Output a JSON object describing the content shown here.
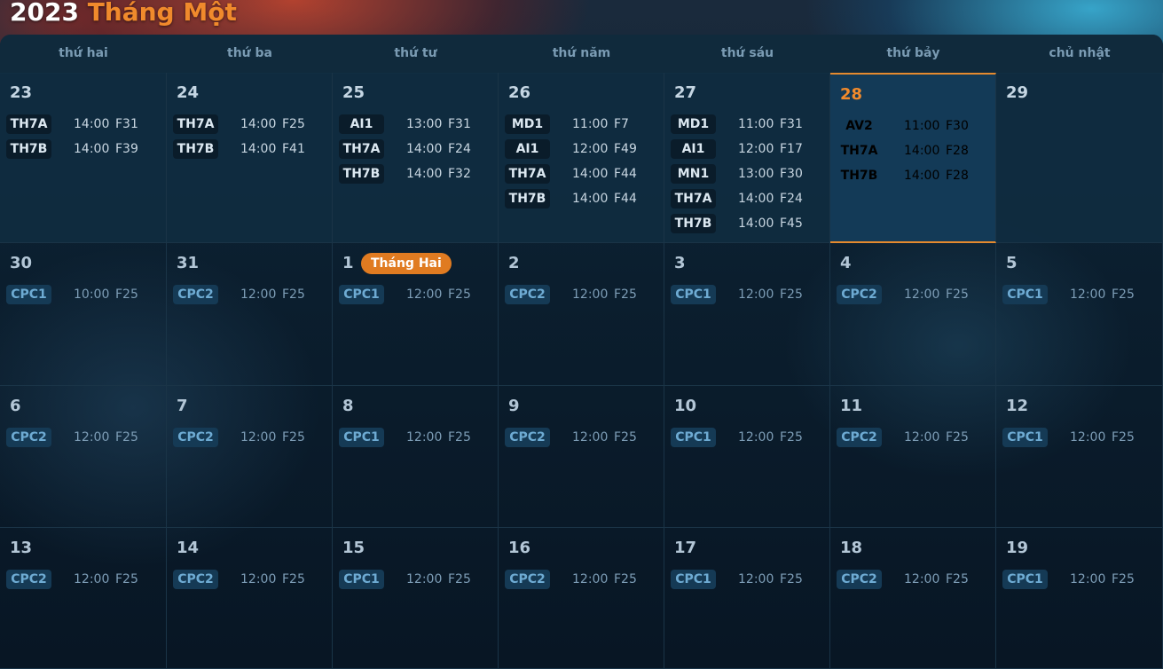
{
  "header": {
    "year": "2023",
    "month": "Tháng Một"
  },
  "weekdays": [
    "thứ hai",
    "thứ ba",
    "thứ tư",
    "thứ năm",
    "thứ sáu",
    "thứ bảy",
    "chủ nhật"
  ],
  "weeks": [
    [
      {
        "day": "23",
        "state": "past",
        "events": [
          {
            "code": "TH7A",
            "time": "14:00",
            "room": "F31"
          },
          {
            "code": "TH7B",
            "time": "14:00",
            "room": "F39"
          }
        ]
      },
      {
        "day": "24",
        "state": "past",
        "events": [
          {
            "code": "TH7A",
            "time": "14:00",
            "room": "F25"
          },
          {
            "code": "TH7B",
            "time": "14:00",
            "room": "F41"
          }
        ]
      },
      {
        "day": "25",
        "state": "past",
        "events": [
          {
            "code": "AI1",
            "time": "13:00",
            "room": "F31"
          },
          {
            "code": "TH7A",
            "time": "14:00",
            "room": "F24"
          },
          {
            "code": "TH7B",
            "time": "14:00",
            "room": "F32"
          }
        ]
      },
      {
        "day": "26",
        "state": "past",
        "events": [
          {
            "code": "MD1",
            "time": "11:00",
            "room": "F7"
          },
          {
            "code": "AI1",
            "time": "12:00",
            "room": "F49"
          },
          {
            "code": "TH7A",
            "time": "14:00",
            "room": "F44"
          },
          {
            "code": "TH7B",
            "time": "14:00",
            "room": "F44"
          }
        ]
      },
      {
        "day": "27",
        "state": "past",
        "events": [
          {
            "code": "MD1",
            "time": "11:00",
            "room": "F31"
          },
          {
            "code": "AI1",
            "time": "12:00",
            "room": "F17"
          },
          {
            "code": "MN1",
            "time": "13:00",
            "room": "F30"
          },
          {
            "code": "TH7A",
            "time": "14:00",
            "room": "F24"
          },
          {
            "code": "TH7B",
            "time": "14:00",
            "room": "F45"
          }
        ]
      },
      {
        "day": "28",
        "state": "today",
        "events": [
          {
            "code": "AV2",
            "time": "11:00",
            "room": "F30"
          },
          {
            "code": "TH7A",
            "time": "14:00",
            "room": "F28"
          },
          {
            "code": "TH7B",
            "time": "14:00",
            "room": "F28"
          }
        ]
      },
      {
        "day": "29",
        "state": "past",
        "events": []
      }
    ],
    [
      {
        "day": "30",
        "state": "future",
        "events": [
          {
            "code": "CPC1",
            "time": "10:00",
            "room": "F25"
          }
        ]
      },
      {
        "day": "31",
        "state": "future",
        "events": [
          {
            "code": "CPC2",
            "time": "12:00",
            "room": "F25"
          }
        ]
      },
      {
        "day": "1",
        "state": "future",
        "badge": "Tháng Hai",
        "events": [
          {
            "code": "CPC1",
            "time": "12:00",
            "room": "F25"
          }
        ]
      },
      {
        "day": "2",
        "state": "future",
        "events": [
          {
            "code": "CPC2",
            "time": "12:00",
            "room": "F25"
          }
        ]
      },
      {
        "day": "3",
        "state": "future",
        "events": [
          {
            "code": "CPC1",
            "time": "12:00",
            "room": "F25"
          }
        ]
      },
      {
        "day": "4",
        "state": "future",
        "events": [
          {
            "code": "CPC2",
            "time": "12:00",
            "room": "F25"
          }
        ]
      },
      {
        "day": "5",
        "state": "future",
        "events": [
          {
            "code": "CPC1",
            "time": "12:00",
            "room": "F25"
          }
        ]
      }
    ],
    [
      {
        "day": "6",
        "state": "future",
        "events": [
          {
            "code": "CPC2",
            "time": "12:00",
            "room": "F25"
          }
        ]
      },
      {
        "day": "7",
        "state": "future",
        "events": [
          {
            "code": "CPC2",
            "time": "12:00",
            "room": "F25"
          }
        ]
      },
      {
        "day": "8",
        "state": "future",
        "events": [
          {
            "code": "CPC1",
            "time": "12:00",
            "room": "F25"
          }
        ]
      },
      {
        "day": "9",
        "state": "future",
        "events": [
          {
            "code": "CPC2",
            "time": "12:00",
            "room": "F25"
          }
        ]
      },
      {
        "day": "10",
        "state": "future",
        "events": [
          {
            "code": "CPC1",
            "time": "12:00",
            "room": "F25"
          }
        ]
      },
      {
        "day": "11",
        "state": "future",
        "events": [
          {
            "code": "CPC2",
            "time": "12:00",
            "room": "F25"
          }
        ]
      },
      {
        "day": "12",
        "state": "future",
        "events": [
          {
            "code": "CPC1",
            "time": "12:00",
            "room": "F25"
          }
        ]
      }
    ],
    [
      {
        "day": "13",
        "state": "future",
        "events": [
          {
            "code": "CPC2",
            "time": "12:00",
            "room": "F25"
          }
        ]
      },
      {
        "day": "14",
        "state": "future",
        "events": [
          {
            "code": "CPC2",
            "time": "12:00",
            "room": "F25"
          }
        ]
      },
      {
        "day": "15",
        "state": "future",
        "events": [
          {
            "code": "CPC1",
            "time": "12:00",
            "room": "F25"
          }
        ]
      },
      {
        "day": "16",
        "state": "future",
        "events": [
          {
            "code": "CPC2",
            "time": "12:00",
            "room": "F25"
          }
        ]
      },
      {
        "day": "17",
        "state": "future",
        "events": [
          {
            "code": "CPC1",
            "time": "12:00",
            "room": "F25"
          }
        ]
      },
      {
        "day": "18",
        "state": "future",
        "events": [
          {
            "code": "CPC2",
            "time": "12:00",
            "room": "F25"
          }
        ]
      },
      {
        "day": "19",
        "state": "future",
        "events": [
          {
            "code": "CPC1",
            "time": "12:00",
            "room": "F25"
          }
        ]
      }
    ]
  ],
  "colors": {
    "accent": "#f08a2c",
    "badge": "#e07b21",
    "past_cell": "#102c40",
    "today_cell": "#133a57"
  }
}
